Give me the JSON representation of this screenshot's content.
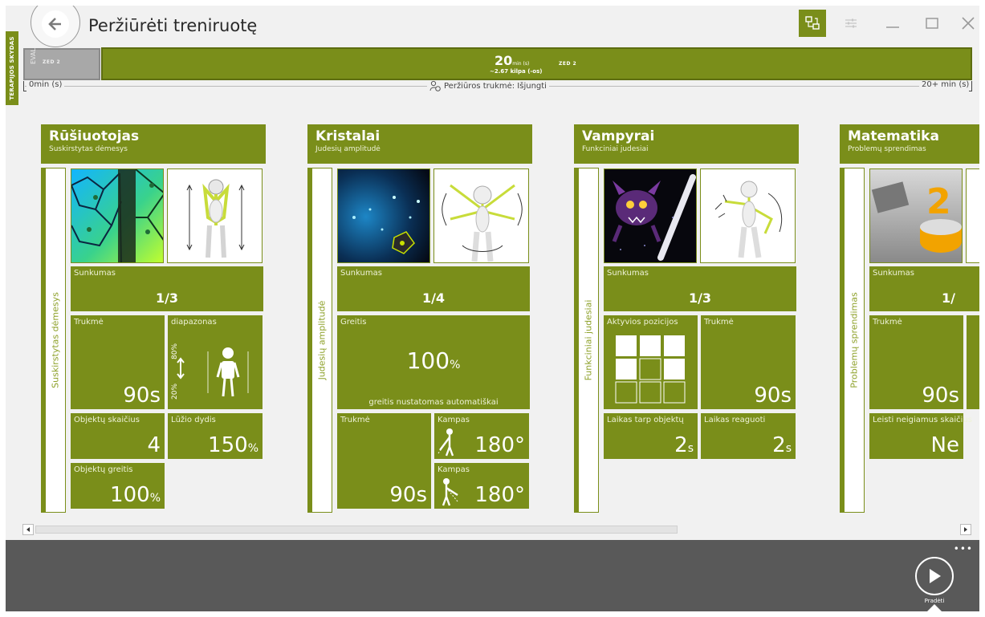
{
  "window": {
    "title": "Peržiūrėti treniruotę",
    "side_tab": "TERAPIJOS SKYDAS"
  },
  "timeline": {
    "eval_label": "EVAL",
    "eval_zed": "ZED 2",
    "minutes": "20",
    "minutes_unit": "min (s)",
    "laps": "~2.67 kilpa (-os)",
    "zed": "ZED 2",
    "start": "0min (s)",
    "preview": "Peržiūros trukmė: Išjungti",
    "end": "20+ min (s)"
  },
  "cards": [
    {
      "name": "Rūšiuotojas",
      "subtitle": "Suskirstytas dėmesys",
      "strip": "Suskirstytas dėmesys",
      "difficulty_label": "Sunkumas",
      "difficulty": "1/3",
      "duration_label": "Trukmė",
      "duration": "90s",
      "range_label": "diapazonas",
      "range_low": "20%",
      "range_high": "80%",
      "count_label": "Objektų skaičius",
      "count": "4",
      "break_label": "Lūžio dydis",
      "break_value": "150",
      "break_unit": "%",
      "speed_label": "Objektų greitis",
      "speed_value": "100",
      "speed_unit": "%"
    },
    {
      "name": "Kristalai",
      "subtitle": "Judesių amplitudė",
      "strip": "Judesių amplitudė",
      "difficulty_label": "Sunkumas",
      "difficulty": "1/4",
      "speed_label": "Greitis",
      "speed_value": "100",
      "speed_unit": "%",
      "speed_note": "greitis nustatomas automatiškai",
      "duration_label": "Trukmė",
      "duration": "90s",
      "angle1_label": "Kampas",
      "angle1": "180",
      "angle2_label": "Kampas",
      "angle2": "180",
      "degree": "°"
    },
    {
      "name": "Vampyrai",
      "subtitle": "Funkciniai judesiai",
      "strip": "Funkciniai judesiai",
      "difficulty_label": "Sunkumas",
      "difficulty": "1/3",
      "positions_label": "Aktyvios pozicijos",
      "duration_label": "Trukmė",
      "duration": "90s",
      "interval_label": "Laikas tarp objektų",
      "interval": "2",
      "react_label": "Laikas reaguoti",
      "react": "2",
      "unit_s": "s"
    },
    {
      "name": "Matematika",
      "subtitle": "Problemų sprendimas",
      "strip": "Problemų sprendimas",
      "difficulty_label": "Sunkumas",
      "difficulty": "1/",
      "duration_label": "Trukmė",
      "duration": "90s",
      "negative_label": "Leisti neigiamus skaičius",
      "negative": "Ne"
    }
  ],
  "footer": {
    "more": "•••",
    "play_label": "Pradėti"
  },
  "colors": {
    "accent": "#7a8e1a",
    "bottom_bar": "#595959"
  }
}
